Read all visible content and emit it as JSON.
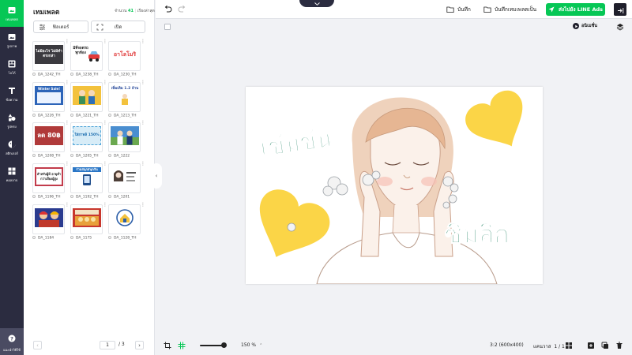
{
  "rail": {
    "items": [
      {
        "label": "เทมเพลต",
        "icon": "template-icon",
        "active": true
      },
      {
        "label": "รูปภาพ",
        "icon": "image-icon"
      },
      {
        "label": "โลโก้",
        "icon": "logo-icon"
      },
      {
        "label": "ข้อความ",
        "icon": "text-icon"
      },
      {
        "label": "รูปทรง",
        "icon": "shapes-icon"
      },
      {
        "label": "สติกเกอร์",
        "icon": "sticker-icon"
      },
      {
        "label": "คอลลาจ",
        "icon": "collage-icon"
      }
    ],
    "help_label": "แนะนำวิธีใช้"
  },
  "panel": {
    "title": "เทมเพลต",
    "count_label": "จำนวน",
    "count": "41",
    "sort_label": "เรียงล่าสุด",
    "filter_label": "ฟิลเตอร์",
    "open_label": "เปิด",
    "templates": [
      {
        "name": "DA_1242_TH",
        "text": "ไม่มีอะไร ไม่มีคำตรงกล่า"
      },
      {
        "name": "DA_1238_TH",
        "text": "มีที่จอดรถ ทุกห้อง"
      },
      {
        "name": "DA_1230_TH",
        "text": "อาโลโมริ"
      },
      {
        "name": "DA_1226_TH",
        "text": "Winter Sale!"
      },
      {
        "name": "DA_1221_TH",
        "text": ""
      },
      {
        "name": "DA_1213_TH",
        "text": "เพิ่มเติม 1.2 ล้าน"
      },
      {
        "name": "DA_1208_TH",
        "text": "ลด 80฿"
      },
      {
        "name": "DA_1205_TH",
        "text": "ใส่ยาพลิ 150%"
      },
      {
        "name": "DA_1222",
        "text": ""
      },
      {
        "name": "DA_1196_TH",
        "text": "สำหรับผู้มี อายุต่ำกว่าเสียงผู้สูง"
      },
      {
        "name": "DA_1192_TH",
        "text": "ร่วมสนุกสนุกกัน"
      },
      {
        "name": "DA_1201",
        "text": ""
      },
      {
        "name": "DA_1184",
        "text": ""
      },
      {
        "name": "DA_1175",
        "text": ""
      },
      {
        "name": "DA_1128_TH",
        "text": ""
      }
    ],
    "pager": {
      "current": "1",
      "total": "/ 3"
    }
  },
  "topbar": {
    "save_label": "บันทึก",
    "save_template_label": "บันทึกเทมเพลตเป็น",
    "send_label": "ส่งไปยัง LINE Ads"
  },
  "canvas": {
    "animate_label": "อนิเมชั่น",
    "text_strong": "เข้มข้น",
    "text_deep": "ซึมลึก"
  },
  "bottombar": {
    "zoom": "150 %",
    "size": "3:2 (600x400)",
    "frame_label": "แคนวาส",
    "frame_pages": "1 / 1"
  },
  "colors": {
    "accent": "#06c755",
    "rail": "#2b2c40",
    "heart": "#fbd547",
    "headline": "#2f8a6e"
  }
}
